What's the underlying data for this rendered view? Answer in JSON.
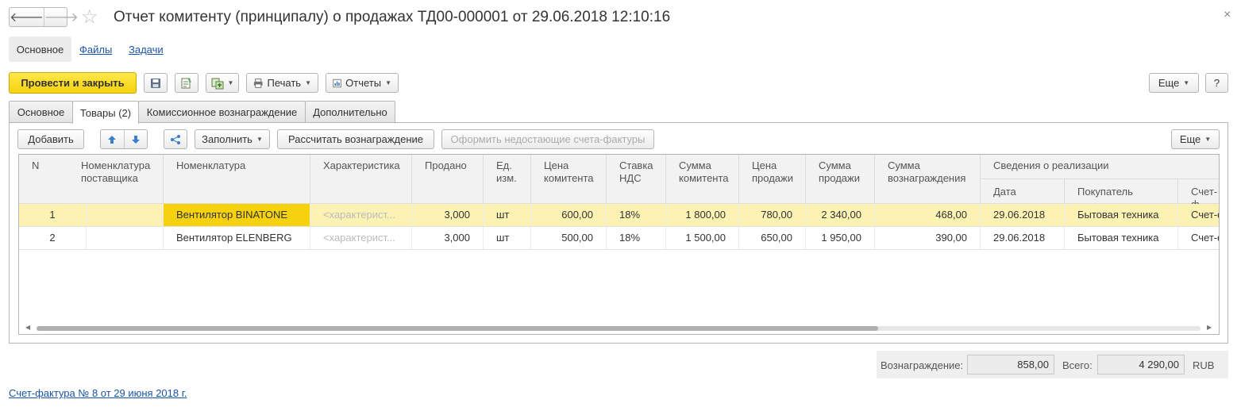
{
  "window": {
    "title": "Отчет комитенту (принципалу) о продажах ТД00-000001 от 29.06.2018 12:10:16",
    "back_glyph": "🡐",
    "forward_glyph": "🡒",
    "star_glyph": "☆",
    "close_glyph": "×"
  },
  "sections": {
    "active": "Основное",
    "links": [
      "Файлы",
      "Задачи"
    ]
  },
  "toolbar": {
    "post_close": "Провести и закрыть",
    "print": "Печать",
    "reports": "Отчеты",
    "more": "Еще",
    "help": "?"
  },
  "tabs": [
    "Основное",
    "Товары (2)",
    "Комиссионное вознаграждение",
    "Дополнительно"
  ],
  "table_toolbar": {
    "add": "Добавить",
    "fill": "Заполнить",
    "calc": "Рассчитать вознаграждение",
    "invoices": "Оформить недостающие счета-фактуры",
    "more": "Еще"
  },
  "table": {
    "columns": {
      "n": "N",
      "supplier_item": "Номенклатура поставщика",
      "item": "Номенклатура",
      "characteristic": "Характеристика",
      "sold": "Продано",
      "unit": "Ед. изм.",
      "principal_price": "Цена комитента",
      "vat": "Ставка НДС",
      "principal_sum": "Сумма комитента",
      "sale_price": "Цена продажи",
      "sale_sum": "Сумма продажи",
      "fee_sum": "Сумма вознаграждения",
      "sale_info": "Сведения о реализации",
      "date": "Дата",
      "buyer": "Покупатель",
      "invoice": "Счет-ф"
    },
    "rows": [
      {
        "n": "1",
        "supplier_item": "",
        "item": "Вентилятор BINATONE",
        "characteristic": "<характерист...",
        "sold": "3,000",
        "unit": "шт",
        "principal_price": "600,00",
        "vat": "18%",
        "principal_sum": "1 800,00",
        "sale_price": "780,00",
        "sale_sum": "2 340,00",
        "fee_sum": "468,00",
        "date": "29.06.2018",
        "buyer": "Бытовая техника",
        "invoice": "Счет-ф"
      },
      {
        "n": "2",
        "supplier_item": "",
        "item": "Вентилятор ELENBERG",
        "characteristic": "<характерист...",
        "sold": "3,000",
        "unit": "шт",
        "principal_price": "500,00",
        "vat": "18%",
        "principal_sum": "1 500,00",
        "sale_price": "650,00",
        "sale_sum": "1 950,00",
        "fee_sum": "390,00",
        "date": "29.06.2018",
        "buyer": "Бытовая техника",
        "invoice": "Счет-ф"
      }
    ]
  },
  "totals": {
    "fee_label": "Вознаграждение:",
    "fee_value": "858,00",
    "total_label": "Всего:",
    "total_value": "4 290,00",
    "currency": "RUB"
  },
  "bottom_link": "Счет-фактура № 8 от 29 июня 2018 г."
}
